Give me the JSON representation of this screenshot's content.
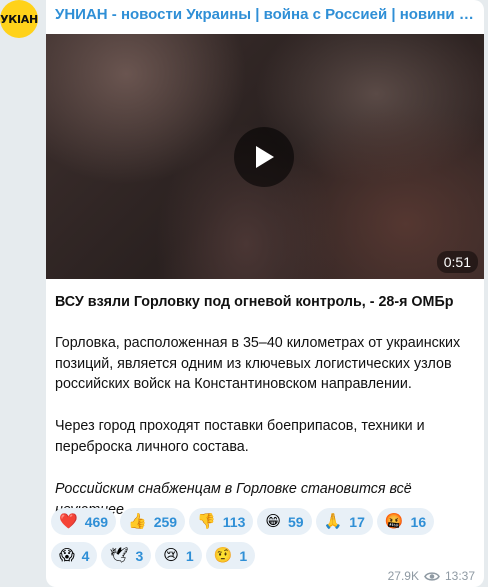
{
  "channel": {
    "avatar_text": "УКIАН",
    "title": "УНИАН - новости Украины | война с Россией | новини України | війна з Росією"
  },
  "video": {
    "duration": "0:51"
  },
  "post": {
    "headline": "ВСУ взяли Горловку под огневой контроль, - 28-я ОМБр",
    "paragraph1": "Горловка, расположенная в 35–40 километрах от украинских позиций, является одним из ключевых логистических узлов российских войск на Константиновском направлении.",
    "paragraph2": "Через город проходят поставки боеприпасов, техники и переброска личного состава.",
    "paragraph3": "Российским снабженцам в Горловке становится всё неуютнее."
  },
  "reactions": [
    {
      "emoji": "❤️",
      "icon": "red-heart-icon",
      "count": "469"
    },
    {
      "emoji": "👍",
      "icon": "thumbs-up-icon",
      "count": "259"
    },
    {
      "emoji": "👎",
      "icon": "thumbs-down-icon",
      "count": "113"
    },
    {
      "emoji": "😁",
      "icon": "grinning-face-icon",
      "count": "59"
    },
    {
      "emoji": "🙏",
      "icon": "praying-hands-icon",
      "count": "17"
    },
    {
      "emoji": "🤬",
      "icon": "cursing-face-icon",
      "count": "16"
    },
    {
      "emoji": "😱",
      "icon": "screaming-face-icon",
      "count": "4"
    },
    {
      "emoji": "🕊",
      "icon": "dove-icon",
      "count": "3"
    },
    {
      "emoji": "😢",
      "icon": "crying-face-icon",
      "count": "1"
    },
    {
      "emoji": "🤨",
      "icon": "raised-eyebrow-face-icon",
      "count": "1"
    }
  ],
  "meta": {
    "views": "27.9K",
    "time": "13:37"
  },
  "colors": {
    "accent": "#2f8fd6",
    "avatar_bg": "#ffd21a",
    "reaction_bg": "#e8f0f7"
  }
}
